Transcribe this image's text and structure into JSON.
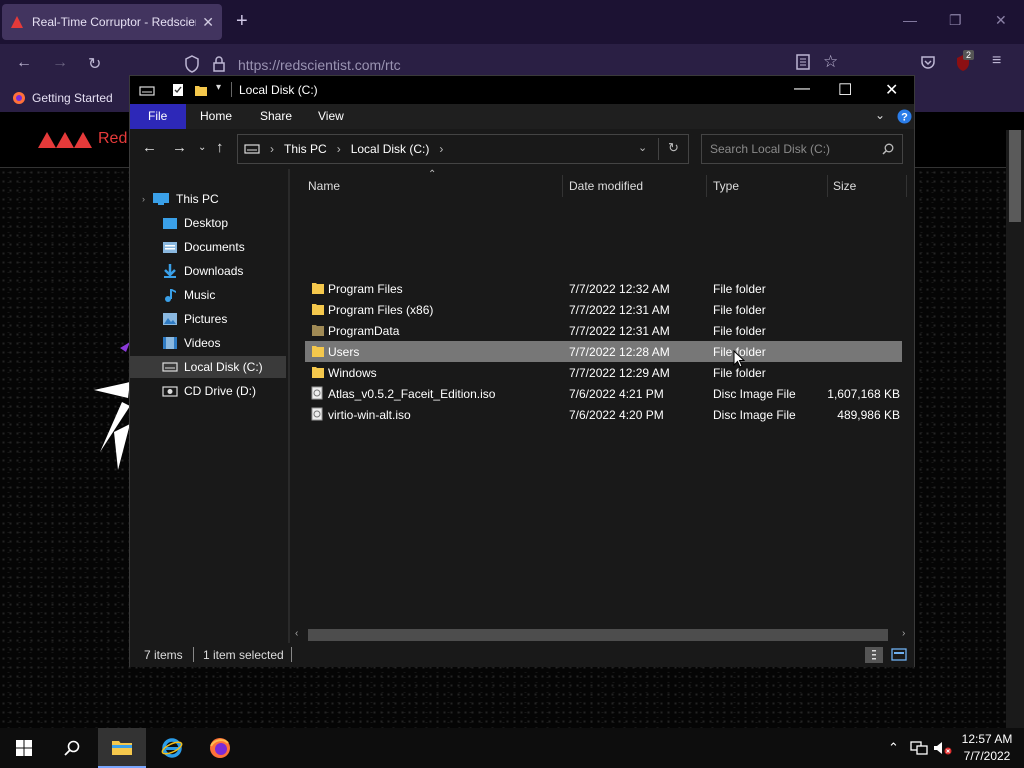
{
  "browser": {
    "tab_title": "Real-Time Corruptor - Redscientist",
    "url": "https://redscientist.com/rtc",
    "bookmark": "Getting Started",
    "extension_badge": "2",
    "site_logo_text": "Red"
  },
  "explorer": {
    "title": "Local Disk (C:)",
    "ribbon_tabs": [
      "File",
      "Home",
      "Share",
      "View"
    ],
    "breadcrumb": [
      "This PC",
      "Local Disk (C:)"
    ],
    "search_placeholder": "Search Local Disk (C:)",
    "nav_items": [
      {
        "label": "This PC",
        "icon": "computer-icon"
      },
      {
        "label": "Desktop",
        "icon": "desktop-icon"
      },
      {
        "label": "Documents",
        "icon": "documents-icon"
      },
      {
        "label": "Downloads",
        "icon": "downloads-icon"
      },
      {
        "label": "Music",
        "icon": "music-icon"
      },
      {
        "label": "Pictures",
        "icon": "pictures-icon"
      },
      {
        "label": "Videos",
        "icon": "videos-icon"
      },
      {
        "label": "Local Disk (C:)",
        "icon": "drive-icon"
      },
      {
        "label": "CD Drive (D:)",
        "icon": "cd-drive-icon"
      }
    ],
    "selected_nav": "Local Disk (C:)",
    "columns": {
      "name": "Name",
      "date": "Date modified",
      "type": "Type",
      "size": "Size"
    },
    "files": [
      {
        "name": "Program Files",
        "date": "7/7/2022 12:32 AM",
        "type": "File folder",
        "size": "",
        "icon": "folder-icon"
      },
      {
        "name": "Program Files (x86)",
        "date": "7/7/2022 12:31 AM",
        "type": "File folder",
        "size": "",
        "icon": "folder-icon"
      },
      {
        "name": "ProgramData",
        "date": "7/7/2022 12:31 AM",
        "type": "File folder",
        "size": "",
        "icon": "folder-icon"
      },
      {
        "name": "Users",
        "date": "7/7/2022 12:28 AM",
        "type": "File folder",
        "size": "",
        "icon": "folder-icon"
      },
      {
        "name": "Windows",
        "date": "7/7/2022 12:29 AM",
        "type": "File folder",
        "size": "",
        "icon": "folder-icon"
      },
      {
        "name": "Atlas_v0.5.2_Faceit_Edition.iso",
        "date": "7/6/2022 4:21 PM",
        "type": "Disc Image File",
        "size": "1,607,168 KB",
        "icon": "disc-image-icon"
      },
      {
        "name": "virtio-win-alt.iso",
        "date": "7/6/2022 4:20 PM",
        "type": "Disc Image File",
        "size": "489,986 KB",
        "icon": "disc-image-icon"
      }
    ],
    "selected_file": "Users",
    "status_items": "7 items",
    "status_selected": "1 item selected"
  },
  "taskbar": {
    "time": "12:57 AM",
    "date": "7/7/2022"
  },
  "colors": {
    "browser_tab_bar": "#1c1233",
    "browser_toolbar": "#2a1f44",
    "ribbon_file_tab": "#2d28b8",
    "folder_yellow": "#f5c84c",
    "selected_row": "#777777",
    "logo_red": "#e53a3a"
  }
}
